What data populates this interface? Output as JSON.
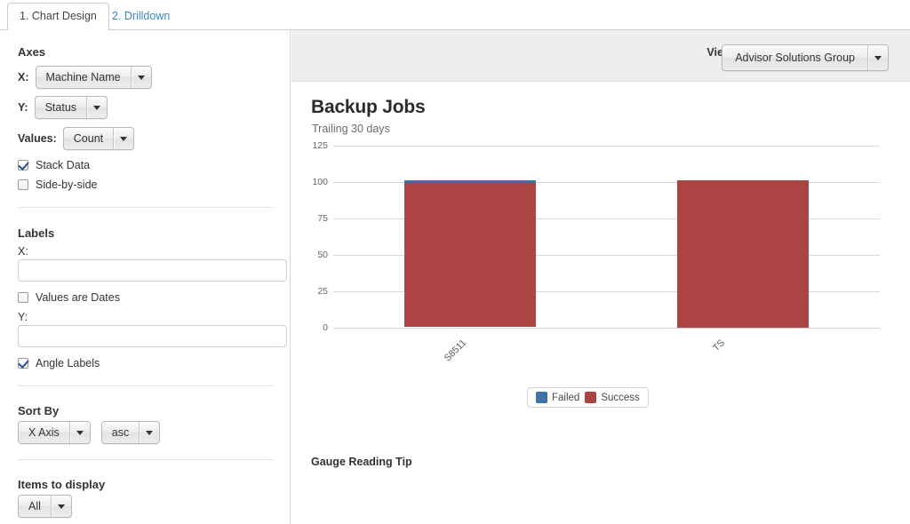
{
  "tabs": [
    {
      "label": "1. Chart Design",
      "active": true
    },
    {
      "label": "2. Drilldown",
      "active": false
    }
  ],
  "sidebar": {
    "axes": {
      "title": "Axes",
      "x_label": "X:",
      "x_value": "Machine Name",
      "y_label": "Y:",
      "y_value": "Status",
      "values_label": "Values:",
      "values_value": "Count",
      "stack_data": "Stack Data",
      "stack_data_checked": true,
      "side_by_side": "Side-by-side",
      "side_by_side_checked": false
    },
    "labels": {
      "title": "Labels",
      "x_label": "X:",
      "x_value": "",
      "x_placeholder": "",
      "values_are_dates": "Values are Dates",
      "values_are_dates_checked": false,
      "y_label": "Y:",
      "y_value": "",
      "y_placeholder": "",
      "angle_labels": "Angle Labels",
      "angle_labels_checked": true
    },
    "sort_by": {
      "title": "Sort By",
      "field_value": "X Axis",
      "direction_value": "asc"
    },
    "items_to_display": {
      "title": "Items to display",
      "value": "All"
    }
  },
  "header": {
    "view_as_label": "View as",
    "view_as_value": "Advisor Solutions Group"
  },
  "main": {
    "gauge_tip": "Gauge Reading Tip"
  },
  "chart_data": {
    "type": "bar",
    "title": "Backup Jobs",
    "subtitle": "Trailing 30 days",
    "stacked": true,
    "categories": [
      "S8511",
      "TS"
    ],
    "series": [
      {
        "name": "Success",
        "color": "#ab4442",
        "values": [
          99,
          101
        ]
      },
      {
        "name": "Failed",
        "color": "#3f72a8",
        "values": [
          2,
          0
        ]
      }
    ],
    "xlabel": "",
    "ylabel": "",
    "ylim": [
      0,
      125
    ],
    "yticks": [
      0,
      25,
      50,
      75,
      100,
      125
    ],
    "ytick_labels": [
      "0",
      "25",
      "50",
      "75",
      "100",
      "125"
    ],
    "grid": true,
    "legend_position": "bottom",
    "legend": [
      "Failed",
      "Success"
    ]
  }
}
